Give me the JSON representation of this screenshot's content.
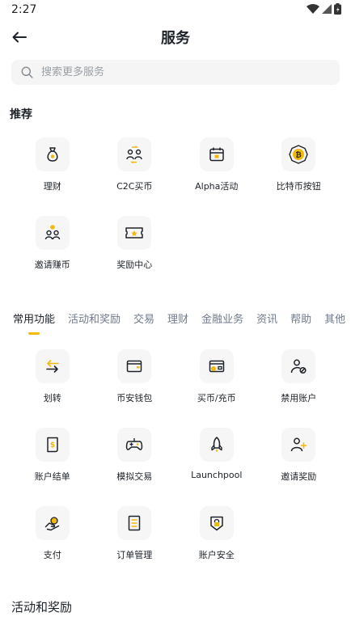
{
  "status_bar": {
    "time": "2:27"
  },
  "header": {
    "title": "服务"
  },
  "search": {
    "placeholder": "搜索更多服务"
  },
  "recommended": {
    "title": "推荐",
    "items": [
      {
        "label": "理财",
        "icon": "money-bag-icon"
      },
      {
        "label": "C2C买币",
        "icon": "users-exchange-icon"
      },
      {
        "label": "Alpha活动",
        "icon": "calendar-icon"
      },
      {
        "label": "比特币按钮",
        "icon": "bitcoin-icon"
      },
      {
        "label": "邀请赚币",
        "icon": "invite-coin-icon"
      },
      {
        "label": "奖励中心",
        "icon": "ticket-icon"
      }
    ]
  },
  "tabs": [
    "常用功能",
    "活动和奖励",
    "交易",
    "理财",
    "金融业务",
    "资讯",
    "帮助",
    "其他"
  ],
  "active_tab": "常用功能",
  "common": {
    "items": [
      {
        "label": "划转",
        "icon": "transfer-icon"
      },
      {
        "label": "币安钱包",
        "icon": "wallet-icon"
      },
      {
        "label": "买币/充币",
        "icon": "buy-crypto-icon"
      },
      {
        "label": "禁用账户",
        "icon": "disable-account-icon"
      },
      {
        "label": "账户结单",
        "icon": "statement-icon"
      },
      {
        "label": "模拟交易",
        "icon": "gamepad-icon"
      },
      {
        "label": "Launchpool",
        "icon": "rocket-icon"
      },
      {
        "label": "邀请奖励",
        "icon": "invite-user-icon"
      },
      {
        "label": "支付",
        "icon": "pay-icon"
      },
      {
        "label": "订单管理",
        "icon": "orders-icon"
      },
      {
        "label": "账户安全",
        "icon": "lock-shield-icon"
      }
    ]
  },
  "bottom_section": {
    "title": "活动和奖励"
  },
  "colors": {
    "accent": "#F0B90B",
    "text": "#1E2329",
    "muted": "#707A8A",
    "tile_bg": "#F6F6F6"
  }
}
